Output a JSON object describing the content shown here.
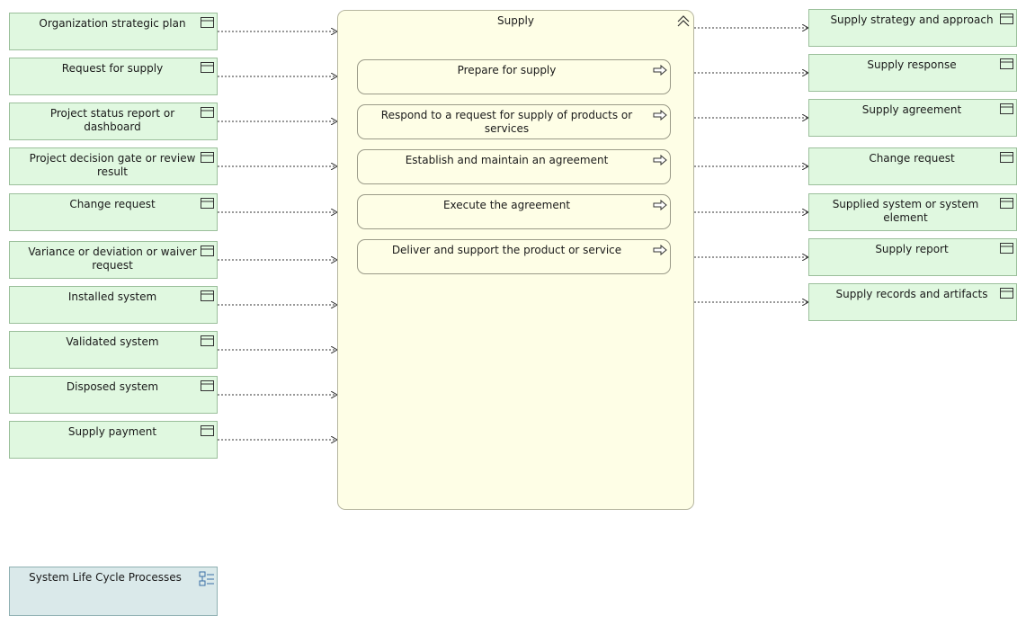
{
  "diagram": {
    "process": {
      "title": "Supply",
      "icon": "collapse-chevron-icon",
      "subprocesses": [
        {
          "label": "Prepare for supply",
          "icon": "process-arrow-icon"
        },
        {
          "label": "Respond to a request for supply of products or services",
          "icon": "process-arrow-icon"
        },
        {
          "label": "Establish and maintain an agreement",
          "icon": "process-arrow-icon"
        },
        {
          "label": "Execute the agreement",
          "icon": "process-arrow-icon"
        },
        {
          "label": "Deliver and support the product or service",
          "icon": "process-arrow-icon"
        }
      ]
    },
    "inputs": [
      {
        "label": "Organization strategic plan",
        "icon": "business-object-icon"
      },
      {
        "label": "Request for supply",
        "icon": "business-object-icon"
      },
      {
        "label": "Project status report or dashboard",
        "icon": "business-object-icon"
      },
      {
        "label": "Project decision gate or review result",
        "icon": "business-object-icon"
      },
      {
        "label": "Change request",
        "icon": "business-object-icon"
      },
      {
        "label": "Variance or deviation or waiver request",
        "icon": "business-object-icon"
      },
      {
        "label": "Installed system",
        "icon": "business-object-icon"
      },
      {
        "label": "Validated system",
        "icon": "business-object-icon"
      },
      {
        "label": "Disposed system",
        "icon": "business-object-icon"
      },
      {
        "label": "Supply payment",
        "icon": "business-object-icon"
      }
    ],
    "outputs": [
      {
        "label": "Supply strategy and approach",
        "icon": "business-object-icon"
      },
      {
        "label": "Supply response",
        "icon": "business-object-icon"
      },
      {
        "label": "Supply agreement",
        "icon": "business-object-icon"
      },
      {
        "label": "Change request",
        "icon": "business-object-icon"
      },
      {
        "label": "Supplied system or system element",
        "icon": "business-object-icon"
      },
      {
        "label": "Supply report",
        "icon": "business-object-icon"
      },
      {
        "label": "Supply records and artifacts",
        "icon": "business-object-icon"
      }
    ],
    "grouping": {
      "label": "System Life Cycle Processes",
      "icon": "grouping-icon"
    },
    "colors": {
      "object_fill": "#e0f8e0",
      "process_fill": "#fefee6",
      "grouping_fill": "#dae9ea",
      "connector": "#333333"
    }
  }
}
